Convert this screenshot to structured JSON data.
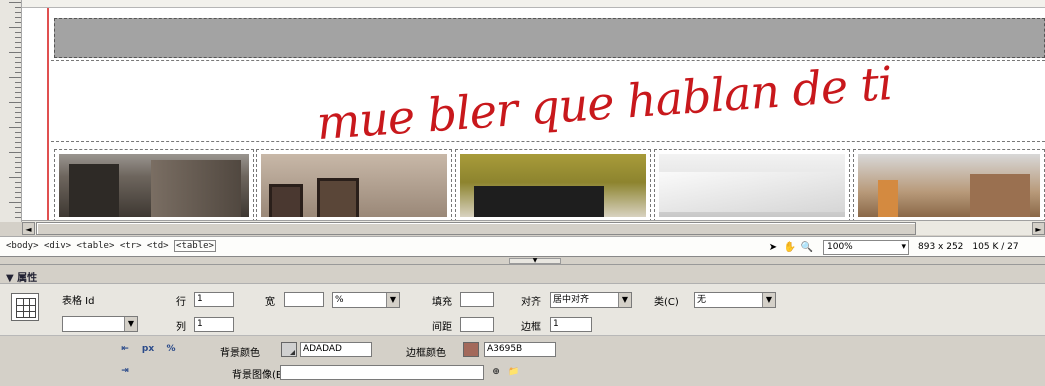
{
  "canvas": {
    "logo_text": "mue bler que hablan de ti"
  },
  "thumbnails": [
    {
      "label": "living room dark walls"
    },
    {
      "label": "hallway with framed pictures"
    },
    {
      "label": "olive wall with tv"
    },
    {
      "label": "white ceiling"
    },
    {
      "label": "warm lit interior"
    }
  ],
  "statusbar": {
    "tag_body": "<body>",
    "tag_div": "<div>",
    "tag_table1": "<table>",
    "tag_tr": "<tr>",
    "tag_td": "<td>",
    "tag_table_current": "<table>",
    "zoom": "100%",
    "window_size": "893 x 252",
    "file_size": "105 K / 27"
  },
  "panel": {
    "title": "▼ 属性",
    "table_id_label": "表格 Id",
    "table_id_value": "",
    "rows_label": "行",
    "rows_value": "1",
    "cols_label": "列",
    "cols_value": "1",
    "width_label": "宽",
    "width_value": "",
    "width_unit": "%",
    "padding_label": "填充",
    "padding_value": "",
    "spacing_label": "间距",
    "spacing_value": "",
    "align_label": "对齐",
    "align_value": "居中对齐",
    "border_label": "边框",
    "border_value": "1",
    "class_label": "类(C)",
    "class_value": "无",
    "bgcolor_label": "背景颜色",
    "bgcolor_value": "ADADAD",
    "bordercolor_label": "边框颜色",
    "bordercolor_value": "A3695B",
    "bgimage_label": "背景图像(B)",
    "bgimage_value": ""
  },
  "colors": {
    "bgcolor_swatch": "#d0d0d0",
    "bordercolor_swatch": "#a3695b",
    "logo": "#c8181c"
  }
}
